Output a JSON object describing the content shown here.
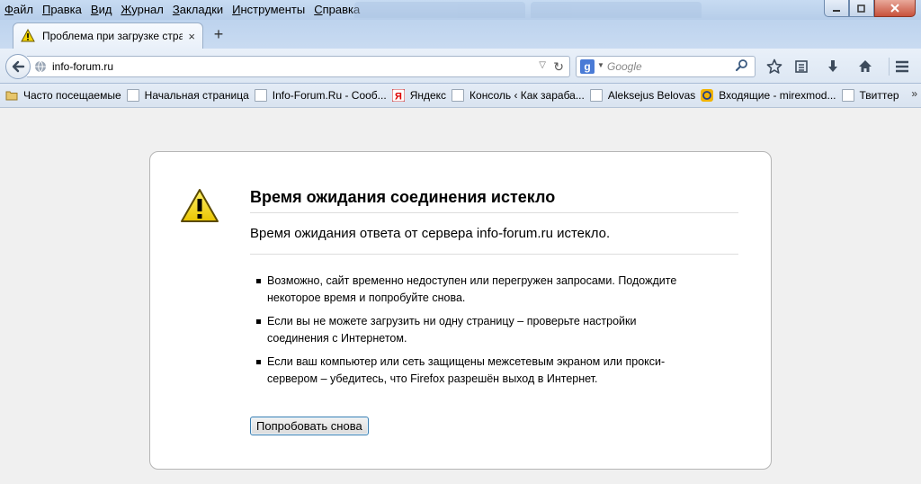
{
  "menu": [
    {
      "acc": "Ф",
      "rest": "айл"
    },
    {
      "acc": "П",
      "rest": "равка"
    },
    {
      "acc": "В",
      "rest": "ид"
    },
    {
      "acc": "Ж",
      "rest": "урнал"
    },
    {
      "acc": "З",
      "rest": "акладки"
    },
    {
      "acc": "И",
      "rest": "нструменты"
    },
    {
      "acc": "С",
      "rest": "правка"
    }
  ],
  "tab": {
    "title": "Проблема при загрузке стра...",
    "close": "×",
    "new_tab": "+"
  },
  "navbar": {
    "url": "info-forum.ru",
    "search_placeholder": "Google"
  },
  "bookmarks": [
    {
      "label": "Часто посещаемые",
      "icon": "bookmark-folder-icon"
    },
    {
      "label": "Начальная страница",
      "icon": "page-icon"
    },
    {
      "label": "Info-Forum.Ru - Сооб...",
      "icon": "page-icon"
    },
    {
      "label": "Яндекс",
      "icon": "yandex-icon"
    },
    {
      "label": "Консоль ‹ Как зараба...",
      "icon": "page-icon"
    },
    {
      "label": "Aleksejus Belovas",
      "icon": "page-icon"
    },
    {
      "label": "Входящие - mirexmod...",
      "icon": "mail-icon"
    },
    {
      "label": "Твиттер",
      "icon": "page-icon"
    }
  ],
  "bookmarks_more": "»",
  "error": {
    "title": "Время ожидания соединения истекло",
    "short": "Время ожидания ответа от сервера info-forum.ru истекло.",
    "items": [
      "Возможно, сайт временно недоступен или перегружен запросами. Подождите некоторое время и попробуйте снова.",
      "Если вы не можете загрузить ни одну страницу – проверьте настройки соединения с Интернетом.",
      "Если ваш компьютер или сеть защищены межсетевым экраном или прокси-сервером – убедитесь, что Firefox разрешён выход в Интернет."
    ],
    "retry": "Попробовать снова"
  },
  "colors": {
    "accent": "#3c7fb1",
    "warning": "#f2d400"
  }
}
